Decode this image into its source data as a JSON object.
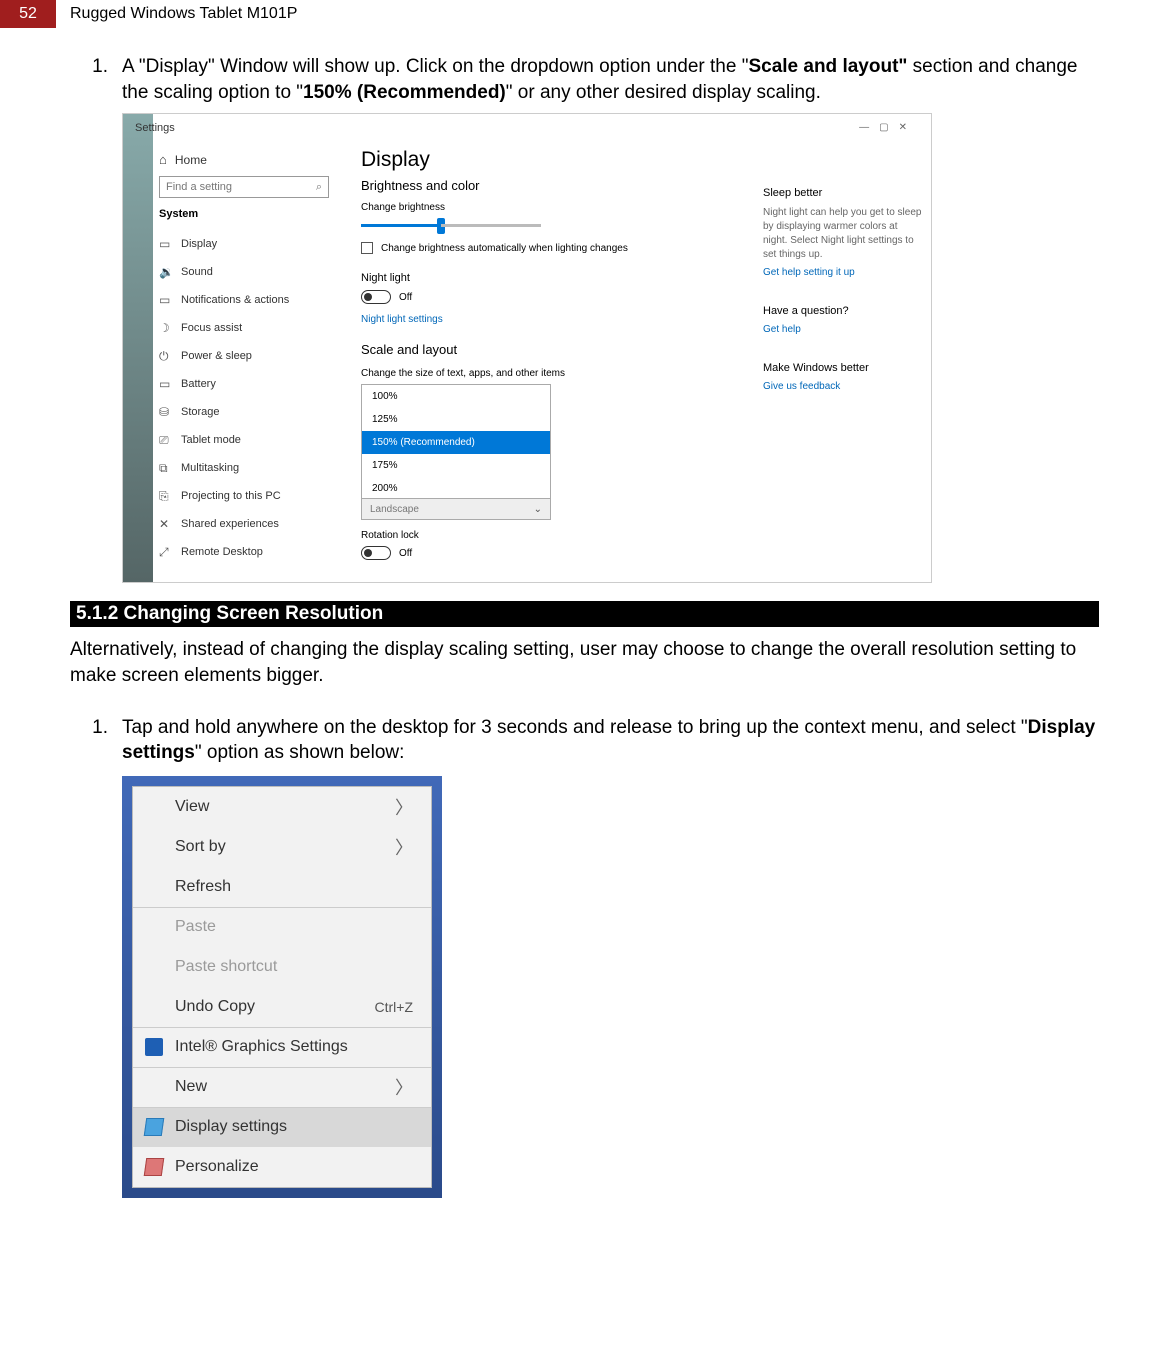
{
  "header": {
    "page_num": "52",
    "title": "Rugged Windows Tablet M101P"
  },
  "step1": {
    "num": "1.",
    "pre": "A \"Display\" Window will show up. Click on the dropdown option under the \"",
    "b1": "Scale and layout\"",
    "mid": " section and change the scaling option to \"",
    "b2": "150% (Recommended)",
    "post": "\" or any other desired display scaling."
  },
  "ss": {
    "win_title": "Settings",
    "min": "—",
    "max": "▢",
    "close": "✕",
    "home": "Home",
    "find_ph": "Find a setting",
    "system": "System",
    "side": [
      {
        "ico": "▭",
        "lbl": "Display"
      },
      {
        "ico": "🔉",
        "lbl": "Sound"
      },
      {
        "ico": "▭",
        "lbl": "Notifications & actions"
      },
      {
        "ico": "☽",
        "lbl": "Focus assist"
      },
      {
        "ico": "⏻",
        "lbl": "Power & sleep"
      },
      {
        "ico": "▭",
        "lbl": "Battery"
      },
      {
        "ico": "⛁",
        "lbl": "Storage"
      },
      {
        "ico": "⎚",
        "lbl": "Tablet mode"
      },
      {
        "ico": "⧉",
        "lbl": "Multitasking"
      },
      {
        "ico": "⎘",
        "lbl": "Projecting to this PC"
      },
      {
        "ico": "✕",
        "lbl": "Shared experiences"
      },
      {
        "ico": "⤢",
        "lbl": "Remote Desktop"
      }
    ],
    "display_h": "Display",
    "bright_h": "Brightness and color",
    "chg_bright": "Change brightness",
    "cb_text": "Change brightness automatically when lighting changes",
    "nl": "Night light",
    "off": "Off",
    "nl_link": "Night light settings",
    "scale_h": "Scale and layout",
    "chg_size": "Change the size of text, apps, and other items",
    "scale_opts": [
      "100%",
      "125%",
      "150% (Recommended)",
      "175%",
      "200%"
    ],
    "orient": "Landscape",
    "rot": "Rotation lock",
    "r": {
      "sleep_h": "Sleep better",
      "sleep_t": "Night light can help you get to sleep by displaying warmer colors at night. Select Night light settings to set things up.",
      "sleep_l": "Get help setting it up",
      "q_h": "Have a question?",
      "q_l": "Get help",
      "w_h": "Make Windows better",
      "w_l": "Give us feedback"
    }
  },
  "section_bar": "5.1.2 Changing Screen Resolution",
  "para": "Alternatively, instead of changing the display scaling setting, user may choose to change the overall resolution setting to make screen elements bigger.",
  "step2": {
    "num": "1.",
    "pre": "Tap and hold anywhere on the desktop for 3 seconds and release to bring up the context menu, and select \"",
    "b": "Display settings",
    "post": "\" option as shown below:"
  },
  "ctx": {
    "view": "View",
    "sort": "Sort by",
    "refresh": "Refresh",
    "paste": "Paste",
    "paste_sc": "Paste shortcut",
    "undo": "Undo Copy",
    "undo_k": "Ctrl+Z",
    "intel": "Intel® Graphics Settings",
    "new": "New",
    "disp": "Display settings",
    "pers": "Personalize"
  }
}
